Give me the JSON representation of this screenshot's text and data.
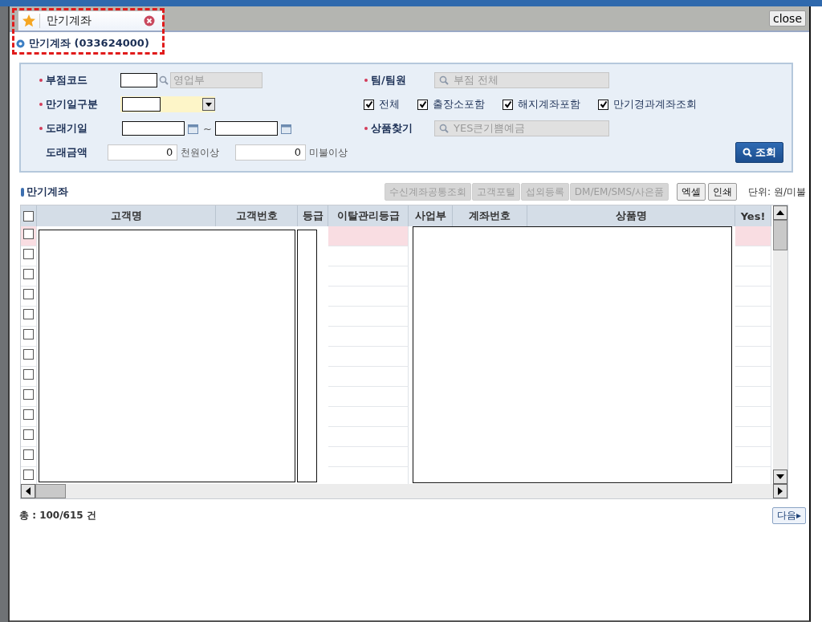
{
  "tab": {
    "label": "만기계좌",
    "selected": true
  },
  "close_button": "close",
  "page_title": "만기계좌 (033624000)",
  "annotation": {
    "kind": "dashed-frame"
  },
  "search_panel": {
    "branch_code": {
      "label": "부점코드",
      "required": true,
      "name": "영업부"
    },
    "team": {
      "label": "팀/팀원",
      "required": true,
      "value": "부점 전체"
    },
    "maturity_type": {
      "label": "만기일구분",
      "required": true
    },
    "options": [
      {
        "label": "전체",
        "checked": true
      },
      {
        "label": "출장소포함",
        "checked": true
      },
      {
        "label": "해지계좌포함",
        "checked": true
      },
      {
        "label": "만기경과계좌조회",
        "checked": true
      }
    ],
    "due_date": {
      "label": "도래기일",
      "required": true,
      "separator": "~"
    },
    "product": {
      "label": "상품찾기",
      "required": true,
      "value": "YES큰기쁨예금"
    },
    "amount": {
      "label": "도래금액",
      "required": false,
      "min_krw": "0",
      "min_krw_unit": "천원이상",
      "min_usd": "0",
      "min_usd_unit": "미불이상"
    },
    "search_button": "조회"
  },
  "section_title": "만기계좌",
  "toolbar": [
    {
      "label": "수신계좌공통조회",
      "disabled": true
    },
    {
      "label": "고객포털",
      "disabled": true
    },
    {
      "label": "섭외등록",
      "disabled": true
    },
    {
      "label": "DM/EM/SMS/사은품",
      "disabled": true
    },
    {
      "label": "엑셀",
      "disabled": false
    },
    {
      "label": "인쇄",
      "disabled": false
    }
  ],
  "unit_note": "단위: 원/미불",
  "table": {
    "columns": [
      "고객명",
      "고객번호",
      "등급",
      "이탈관리등급",
      "사업부",
      "계좌번호",
      "상품명",
      "Yes!"
    ],
    "select_all": {
      "checked": false
    },
    "rows": [
      {
        "checked": false,
        "selected": true
      },
      {
        "checked": false,
        "selected": false
      },
      {
        "checked": false,
        "selected": false
      },
      {
        "checked": false,
        "selected": false
      },
      {
        "checked": false,
        "selected": false
      },
      {
        "checked": false,
        "selected": false
      },
      {
        "checked": false,
        "selected": false
      },
      {
        "checked": false,
        "selected": false
      },
      {
        "checked": false,
        "selected": false
      },
      {
        "checked": false,
        "selected": false
      },
      {
        "checked": false,
        "selected": false
      },
      {
        "checked": false,
        "selected": false
      },
      {
        "checked": false,
        "selected": false
      }
    ]
  },
  "total": "총 : 100/615 건",
  "next_button": "다음▸"
}
